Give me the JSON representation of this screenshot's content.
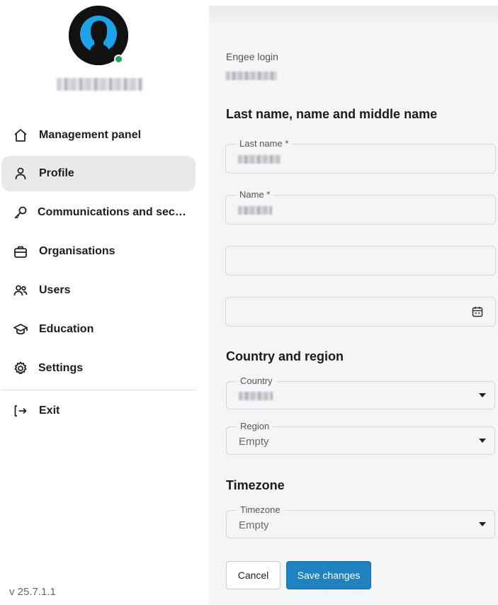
{
  "sidebar": {
    "items": [
      {
        "label": "Management panel",
        "icon": "home-icon"
      },
      {
        "label": "Profile",
        "icon": "user-icon",
        "active": true
      },
      {
        "label": "Communications and security",
        "icon": "key-icon"
      },
      {
        "label": "Organisations",
        "icon": "briefcase-icon"
      },
      {
        "label": "Users",
        "icon": "users-icon"
      },
      {
        "label": "Education",
        "icon": "graduation-cap-icon"
      },
      {
        "label": "Settings",
        "icon": "gear-icon"
      }
    ],
    "exit_label": "Exit",
    "version": "v 25.7.1.1",
    "status_color": "#27a25a"
  },
  "main": {
    "login_label": "Engee login",
    "name_section_title": "Last name, name and middle name",
    "last_name_label": "Last name *",
    "name_label": "Name *",
    "country_section_title": "Country and region",
    "country_label": "Country",
    "region_label": "Region",
    "region_value": "Empty",
    "timezone_section_title": "Timezone",
    "timezone_label": "Timezone",
    "timezone_value": "Empty",
    "cancel_label": "Cancel",
    "save_label": "Save changes",
    "accent_color": "#1e83c0"
  }
}
